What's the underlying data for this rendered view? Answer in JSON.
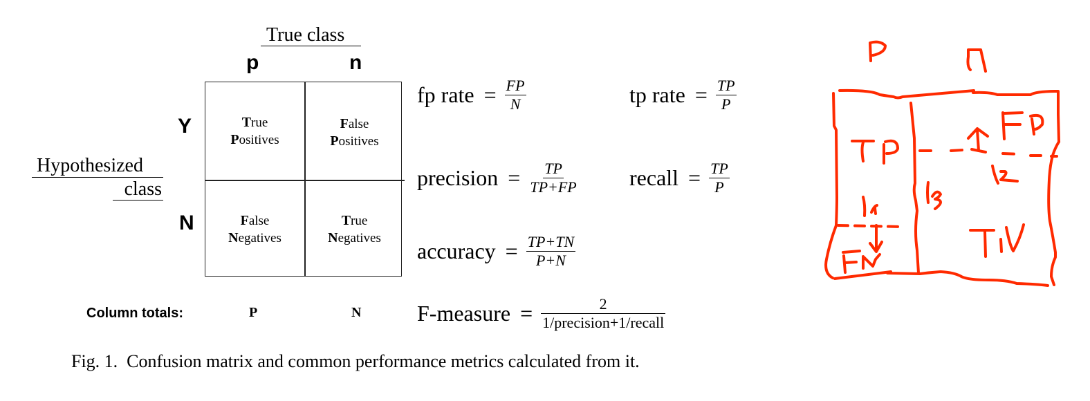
{
  "figure": {
    "true_class_label": "True class",
    "hypothesized_label_line1": "Hypothesized",
    "hypothesized_label_line2": "class",
    "column_headers": [
      "p",
      "n"
    ],
    "row_headers": [
      "Y",
      "N"
    ],
    "cells": [
      {
        "line1_initial": "T",
        "line1_rest": "rue",
        "line2_initial": "P",
        "line2_rest": "ositives"
      },
      {
        "line1_initial": "F",
        "line1_rest": "alse",
        "line2_initial": "P",
        "line2_rest": "ositives"
      },
      {
        "line1_initial": "F",
        "line1_rest": "alse",
        "line2_initial": "N",
        "line2_rest": "egatives"
      },
      {
        "line1_initial": "T",
        "line1_rest": "rue",
        "line2_initial": "N",
        "line2_rest": "egatives"
      }
    ],
    "column_totals_label": "Column totals:",
    "column_totals": [
      "P",
      "N"
    ]
  },
  "formulas": {
    "fp_rate": {
      "name": "fp rate",
      "eq": "=",
      "num": "FP",
      "den": "N"
    },
    "tp_rate": {
      "name": "tp rate",
      "eq": "=",
      "num": "TP",
      "den": "P"
    },
    "precision": {
      "name": "precision",
      "eq": "=",
      "num": "TP",
      "den": "TP+FP"
    },
    "recall": {
      "name": "recall",
      "eq": "=",
      "num": "TP",
      "den": "P"
    },
    "accuracy": {
      "name": "accuracy",
      "eq": "=",
      "num": "TP+TN",
      "den": "P+N"
    },
    "f_measure": {
      "name": "F-measure",
      "eq": "=",
      "num": "2",
      "den": "1/precision+1/recall"
    }
  },
  "caption": "Fig. 1.  Confusion matrix and common performance metrics calculated from it.",
  "annotation": {
    "color": "#ff2a00",
    "column_labels": [
      "P",
      "n"
    ],
    "cell_labels": [
      "TP",
      "FP",
      "FN",
      "TN"
    ],
    "threshold_labels": [
      "l1",
      "l2",
      "l3"
    ]
  }
}
